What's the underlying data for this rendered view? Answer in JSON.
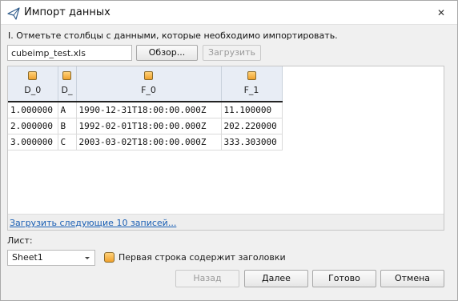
{
  "window": {
    "title": "Импорт данных",
    "close_glyph": "✕",
    "icon": "send-icon"
  },
  "instruction": "I. Отметьте столбцы с данными, которые необходимо импортировать.",
  "file": {
    "value": "cubeimp_test.xls",
    "browse_label": "Обзор...",
    "load_label": "Загрузить",
    "load_enabled": false
  },
  "grid": {
    "columns": [
      {
        "label": "D_0",
        "checked": true
      },
      {
        "label": "D_",
        "checked": true
      },
      {
        "label": "F_0",
        "checked": true
      },
      {
        "label": "F_1",
        "checked": true
      }
    ],
    "rows": [
      [
        "1.000000",
        "A",
        "1990-12-31T18:00:00.000Z",
        "11.100000"
      ],
      [
        "2.000000",
        "B",
        "1992-02-01T18:00:00.000Z",
        "202.220000"
      ],
      [
        "3.000000",
        "C",
        "2003-03-02T18:00:00.000Z",
        "333.303000"
      ]
    ],
    "load_more_label": "Загрузить следующие 10 записей..."
  },
  "sheet": {
    "label": "Лист:",
    "selected": "Sheet1",
    "first_row_header_label": "Первая строка содержит заголовки",
    "first_row_header_checked": true
  },
  "footer": {
    "back_label": "Назад",
    "back_enabled": false,
    "next_label": "Далее",
    "done_label": "Готово",
    "cancel_label": "Отмена"
  },
  "colors": {
    "accent_orange": "#f0a22d",
    "link_blue": "#1a5fb4",
    "header_bg": "#e8edf5"
  }
}
